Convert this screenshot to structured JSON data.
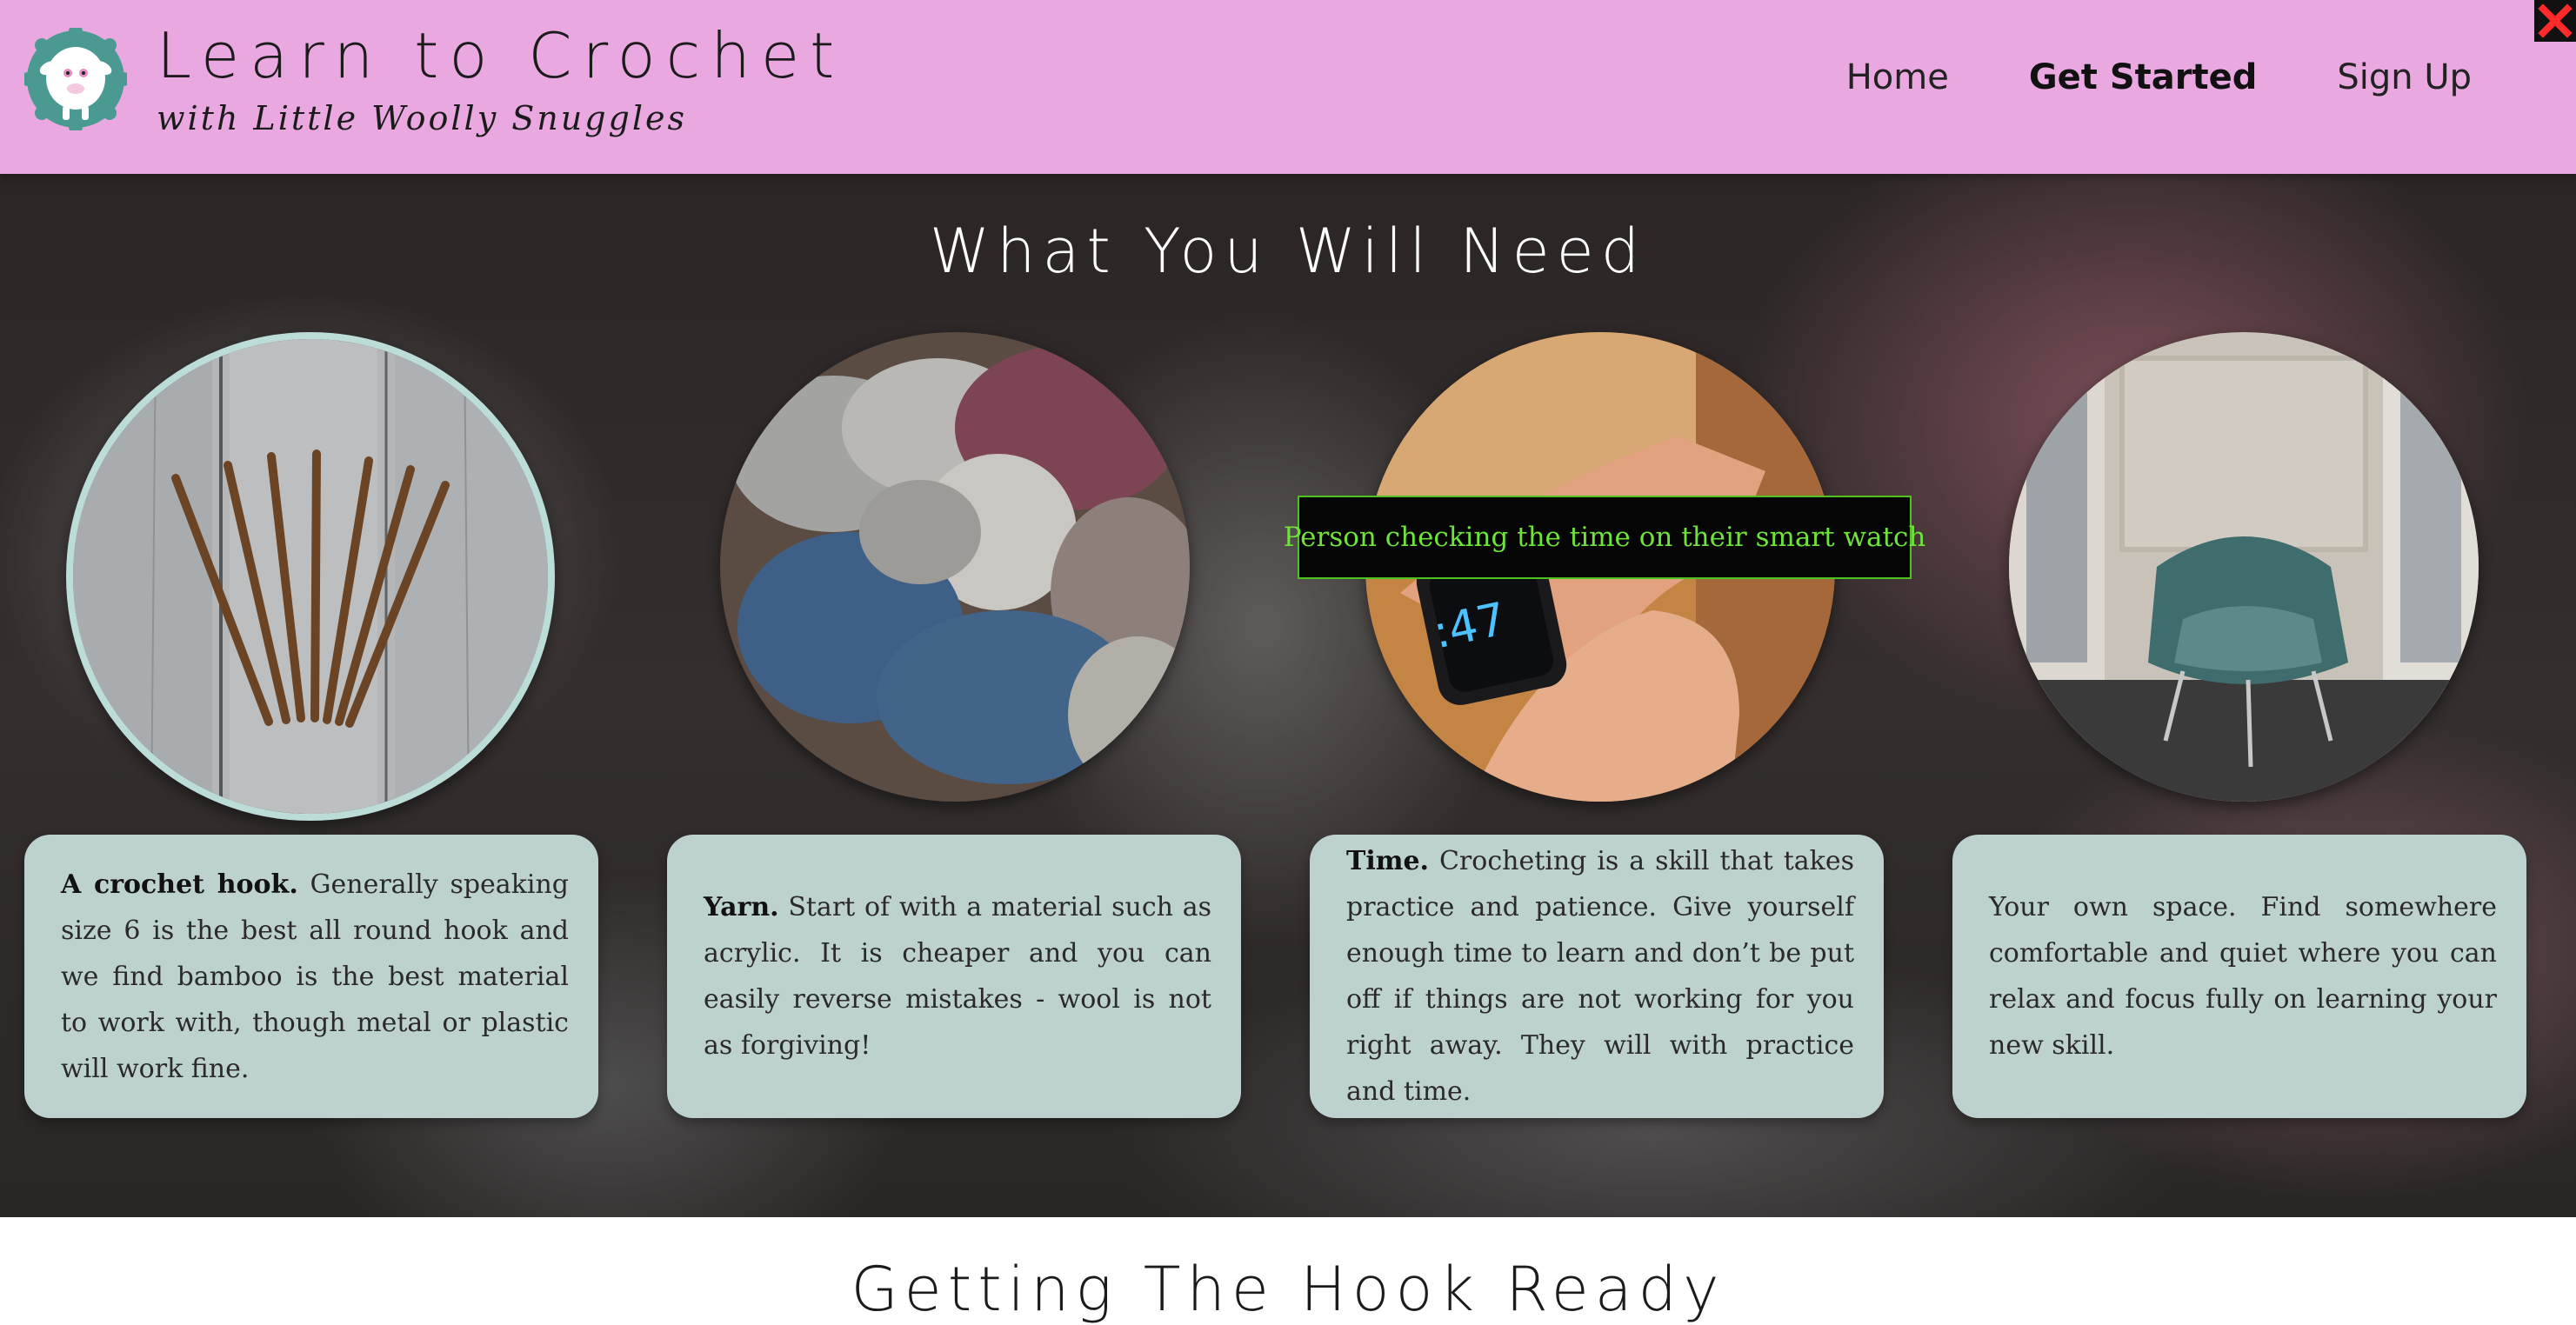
{
  "header": {
    "title": "Learn to Crochet",
    "subtitle": "with Little Woolly Snuggles",
    "logo_icon": "sheep-logo-icon",
    "bg_color": "#e9a9e0"
  },
  "nav": {
    "items": [
      {
        "label": "Home",
        "active": false
      },
      {
        "label": "Get Started",
        "active": true
      },
      {
        "label": "Sign Up",
        "active": false
      }
    ]
  },
  "close_button": {
    "icon": "close-icon",
    "color": "#ff2a2a"
  },
  "main": {
    "section_title": "What You Will Need",
    "items": [
      {
        "image": "crochet-hooks-image",
        "bold": "A crochet hook.",
        "text": " Generally speaking size 6 is the best all round hook and we find bamboo is the best material to work with, though metal or plastic will work fine."
      },
      {
        "image": "yarn-skeins-image",
        "bold": "Yarn.",
        "text": " Start of with a material such as acrylic. It is cheaper and you can easily reverse mistakes - wool is not as forgiving!"
      },
      {
        "image": "smart-watch-image",
        "bold": "Time.",
        "text": " Crocheting is a skill that takes practice and patience. Give yourself enough time to learn and don’t be put off if things are not working for you right away. They will with practice and time."
      },
      {
        "image": "armchair-image",
        "bold": "",
        "text": "Your own space. Find somewhere comfortable and quiet where you can relax and focus fully on learning your new skill."
      }
    ],
    "tooltip": "Person checking the time on their smart watch",
    "watch_time": ":47",
    "card_color": "#bdd1cf"
  },
  "next_section": {
    "title": "Getting The Hook Ready"
  }
}
